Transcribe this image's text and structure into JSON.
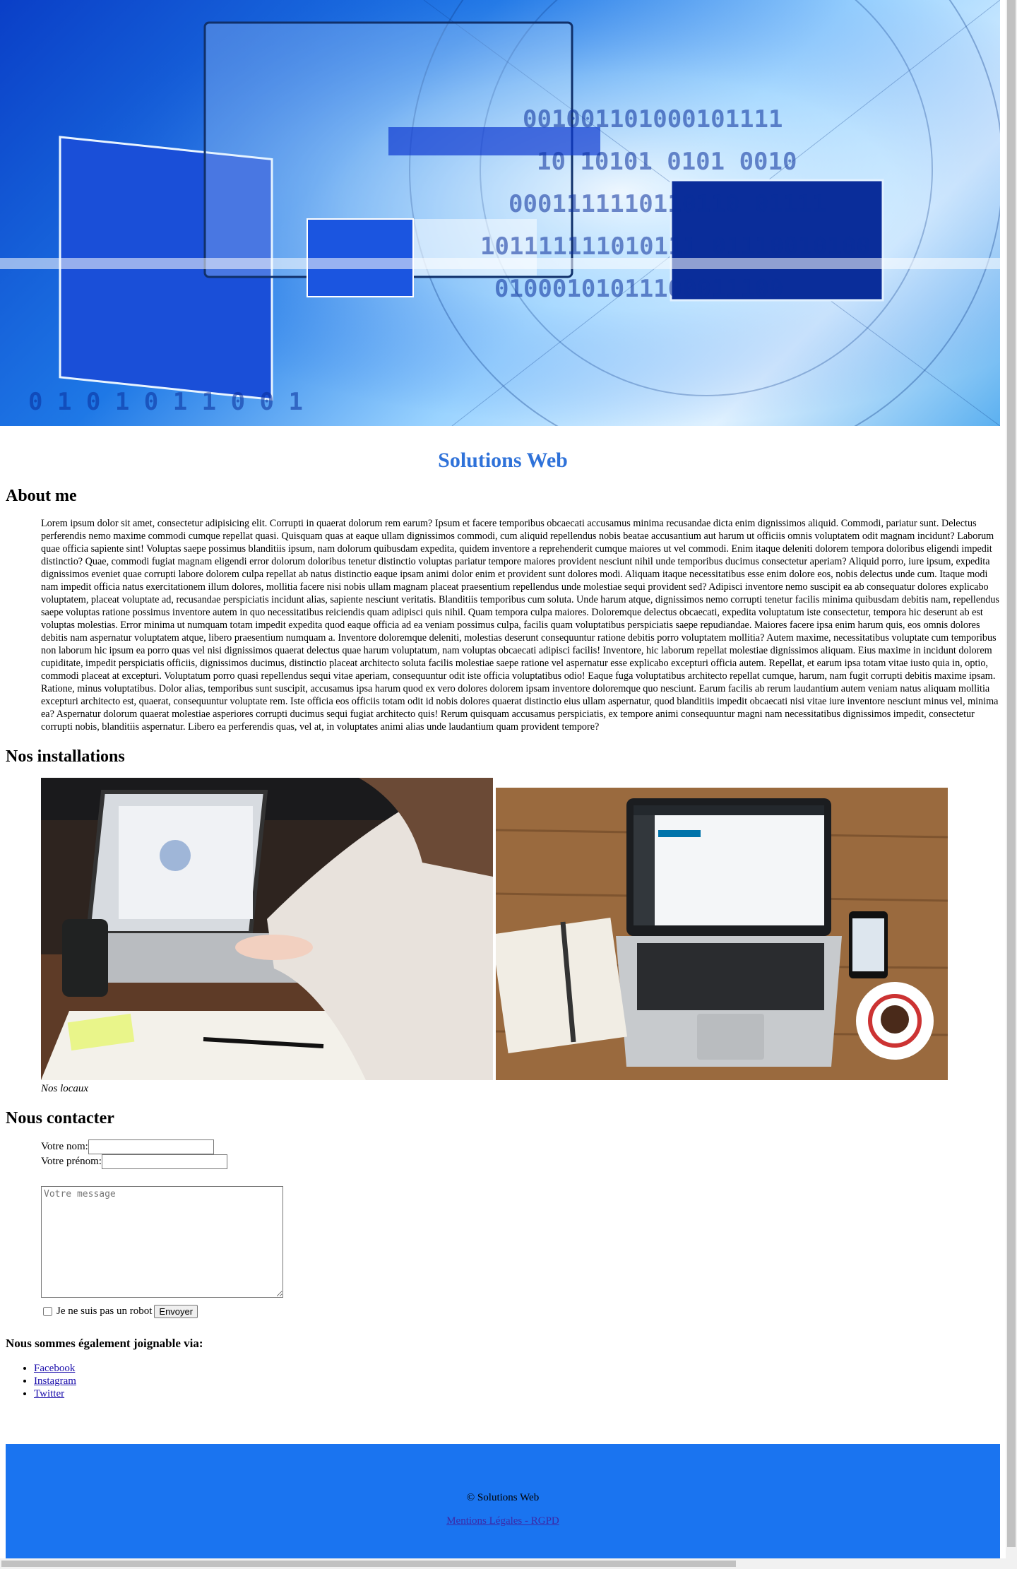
{
  "site": {
    "title": "Solutions Web"
  },
  "about": {
    "heading": "About me",
    "text": "Lorem ipsum dolor sit amet, consectetur adipisicing elit. Corrupti in quaerat dolorum rem earum? Ipsum et facere temporibus obcaecati accusamus minima recusandae dicta enim dignissimos aliquid. Commodi, pariatur sunt. Delectus perferendis nemo maxime commodi cumque repellat quasi. Quisquam quas at eaque ullam dignissimos commodi, cum aliquid repellendus nobis beatae accusantium aut harum ut officiis omnis voluptatem odit magnam incidunt? Laborum quae officia sapiente sint! Voluptas saepe possimus blanditiis ipsum, nam dolorum quibusdam expedita, quidem inventore a reprehenderit cumque maiores ut vel commodi. Enim itaque deleniti dolorem tempora doloribus eligendi impedit distinctio? Quae, commodi fugiat magnam eligendi error dolorum doloribus tenetur distinctio voluptas pariatur tempore maiores provident nesciunt nihil unde temporibus ducimus consectetur aperiam? Aliquid porro, iure ipsum, expedita dignissimos eveniet quae corrupti labore dolorem culpa repellat ab natus distinctio eaque ipsam animi dolor enim et provident sunt dolores modi. Aliquam itaque necessitatibus esse enim dolore eos, nobis delectus unde cum. Itaque modi nam impedit officia natus exercitationem illum dolores, mollitia facere nisi nobis ullam magnam placeat praesentium repellendus unde molestiae sequi provident sed? Adipisci inventore nemo suscipit ea ab consequatur dolores explicabo voluptatem, placeat voluptate ad, recusandae perspiciatis incidunt alias, sapiente nesciunt veritatis. Blanditiis temporibus cum soluta. Unde harum atque, dignissimos nemo corrupti tenetur facilis minima quibusdam debitis nam, repellendus saepe voluptas ratione possimus inventore autem in quo necessitatibus reiciendis quam adipisci quis nihil. Quam tempora culpa maiores. Doloremque delectus obcaecati, expedita voluptatum iste consectetur, tempora hic deserunt ab est voluptas molestias. Error minima ut numquam totam impedit expedita quod eaque officia ad ea veniam possimus culpa, facilis quam voluptatibus perspiciatis saepe repudiandae. Maiores facere ipsa enim harum quis, eos omnis dolores debitis nam aspernatur voluptatem atque, libero praesentium numquam a. Inventore doloremque deleniti, molestias deserunt consequuntur ratione debitis porro voluptatem mollitia? Autem maxime, necessitatibus voluptate cum temporibus non laborum hic ipsum ea porro quas vel nisi dignissimos quaerat delectus quae harum voluptatum, nam voluptas obcaecati adipisci facilis! Inventore, hic laborum repellat molestiae dignissimos aliquam. Eius maxime in incidunt dolorem cupiditate, impedit perspiciatis officiis, dignissimos ducimus, distinctio placeat architecto soluta facilis molestiae saepe ratione vel aspernatur esse explicabo excepturi officia autem. Repellat, et earum ipsa totam vitae iusto quia in, optio, commodi placeat at excepturi. Voluptatum porro quasi repellendus sequi vitae aperiam, consequuntur odit iste officia voluptatibus odio! Eaque fuga voluptatibus architecto repellat cumque, harum, nam fugit corrupti debitis maxime ipsam. Ratione, minus voluptatibus. Dolor alias, temporibus sunt suscipit, accusamus ipsa harum quod ex vero dolores dolorem ipsam inventore doloremque quo nesciunt. Earum facilis ab rerum laudantium autem veniam natus aliquam mollitia excepturi architecto est, quaerat, consequuntur voluptate rem. Iste officia eos officiis totam odit id nobis dolores quaerat distinctio eius ullam aspernatur, quod blanditiis impedit obcaecati nisi vitae iure inventore nesciunt minus vel, minima ea? Aspernatur dolorum quaerat molestiae asperiores corrupti ducimus sequi fugiat architecto quis! Rerum quisquam accusamus perspiciatis, ex tempore animi consequuntur magni nam necessitatibus dignissimos impedit, consectetur corrupti nobis, blanditiis aspernatur. Libero ea perferendis quas, vel at, in voluptates animi alias unde laudantium quam provident tempore?"
  },
  "installations": {
    "heading": "Nos installations",
    "caption": "Nos locaux"
  },
  "contact": {
    "heading": "Nous contacter",
    "name_label": "Votre nom:",
    "name_value": "",
    "firstname_label": "Votre prénom:",
    "firstname_value": "",
    "message_placeholder": "Votre message",
    "robot_label": "Je ne suis pas un robot",
    "submit_label": "Envoyer"
  },
  "social": {
    "heading": "Nous sommes également joignable via:",
    "links": [
      "Facebook",
      "Instagram",
      "Twitter"
    ]
  },
  "footer": {
    "copyright": "© Solutions Web",
    "legal_link": "Mentions Légales - RGPD",
    "background_color": "#1a74f0"
  },
  "colors": {
    "title": "#2f72d9"
  },
  "icons": {
    "hero": "digital-monitors-binary-image",
    "photo1": "laptop-typing-photo",
    "photo2": "laptop-desk-photo"
  }
}
